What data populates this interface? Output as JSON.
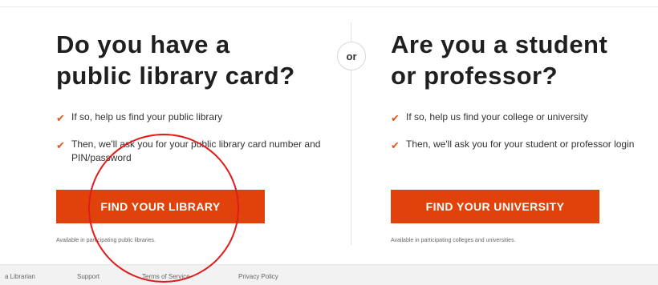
{
  "separator": {
    "or_label": "or"
  },
  "library": {
    "heading_line1": "Do you have a",
    "heading_line2": "public library card?",
    "bullets": [
      "If so, help us find your public library",
      "Then, we'll ask you for your public library card number and PIN/password"
    ],
    "button_label": "FIND YOUR LIBRARY",
    "availability": "Available in participating public libraries."
  },
  "university": {
    "heading_line1": "Are you a student",
    "heading_line2": "or professor?",
    "bullets": [
      "If so, help us find your college or university",
      "Then, we'll ask you for your student or professor login"
    ],
    "button_label": "FIND YOUR UNIVERSITY",
    "availability": "Available in participating colleges and universities."
  },
  "check_glyph": "✔",
  "colors": {
    "accent": "#e1420c",
    "check": "#e4561b",
    "annotation": "#e11a1a"
  },
  "footer": {
    "links": [
      {
        "label": "a Librarian"
      },
      {
        "label": "Support"
      },
      {
        "label": "Terms of Service"
      },
      {
        "label": "Privacy Policy"
      }
    ]
  }
}
